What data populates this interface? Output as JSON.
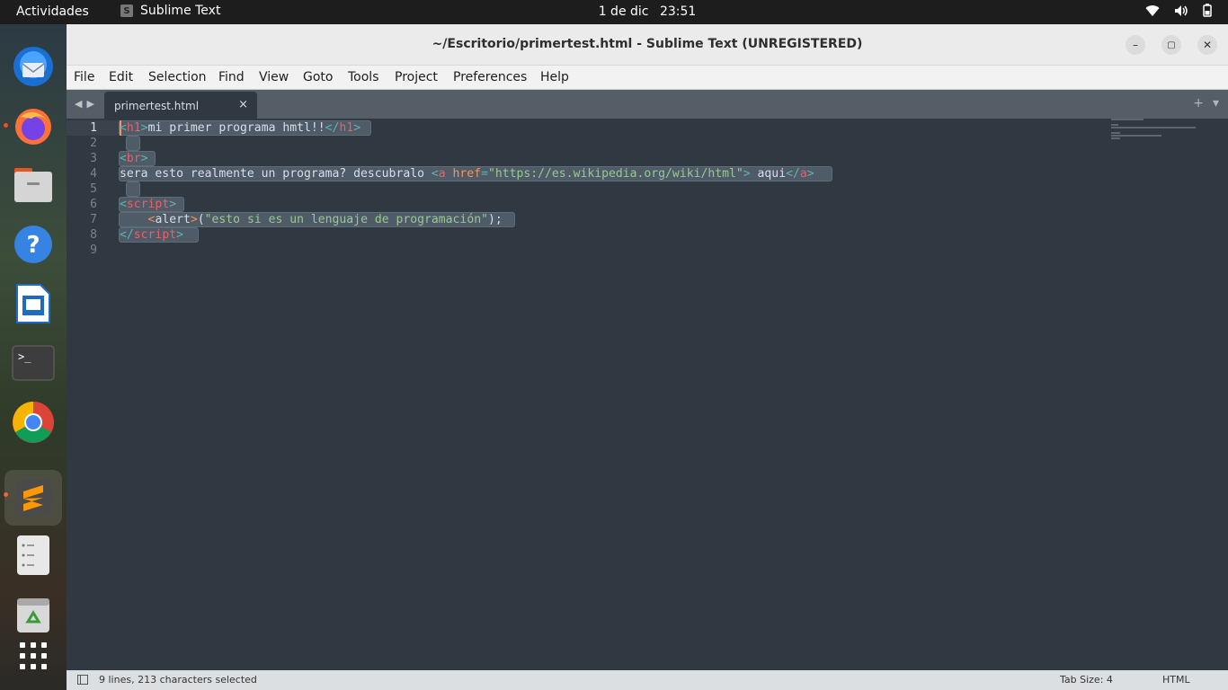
{
  "topbar": {
    "activities": "Actividades",
    "app_name": "Sublime Text",
    "date": "1 de dic",
    "time": "23:51",
    "tray_icons": [
      "wifi-icon",
      "volume-icon",
      "battery-icon"
    ]
  },
  "dock": {
    "items": [
      {
        "name": "thunderbird-icon",
        "active": false,
        "running": false
      },
      {
        "name": "firefox-icon",
        "active": false,
        "running": true
      },
      {
        "name": "files-icon",
        "active": false,
        "running": false
      },
      {
        "name": "help-icon",
        "active": false,
        "running": false
      },
      {
        "name": "libreoffice-writer-icon",
        "active": false,
        "running": false
      },
      {
        "name": "terminal-icon",
        "active": false,
        "running": false
      },
      {
        "name": "chrome-icon",
        "active": false,
        "running": false
      },
      {
        "name": "sublime-text-icon",
        "active": true,
        "running": true
      },
      {
        "name": "text-editor-icon",
        "active": false,
        "running": false
      },
      {
        "name": "trash-icon",
        "active": false,
        "running": false
      },
      {
        "name": "show-apps-icon",
        "active": false,
        "running": false
      }
    ]
  },
  "window": {
    "title": "~/Escritorio/primertest.html - Sublime Text (UNREGISTERED)",
    "controls": {
      "minimize": "–",
      "maximize": "▢",
      "close": "✕"
    }
  },
  "menu": [
    "File",
    "Edit",
    "Selection",
    "Find",
    "View",
    "Goto",
    "Tools",
    "Project",
    "Preferences",
    "Help"
  ],
  "tabs": [
    {
      "label": "primertest.html",
      "close": "×"
    }
  ],
  "tabbar_right": {
    "new_tab": "+",
    "dropdown": "▾"
  },
  "editor": {
    "line_numbers": [
      "1",
      "2",
      "3",
      "4",
      "5",
      "6",
      "7",
      "8",
      "9"
    ],
    "lines": {
      "l1": {
        "o1": "<",
        "t1": "h1",
        "c1": ">",
        "text": "mi primer programa hmtl!!",
        "o2": "</",
        "t2": "h1",
        "c2": ">"
      },
      "l3": {
        "o1": "<",
        "t1": "br",
        "c1": ">"
      },
      "l4": {
        "text": "sera esto realmente un programa? descubralo ",
        "o1": "<",
        "t1": "a",
        "attr": "href",
        "eq": "=",
        "val": "\"https://es.wikipedia.org/wiki/html\"",
        "c1": ">",
        "text2": " aqui",
        "o2": "</",
        "t2": "a",
        "c2": ">"
      },
      "l6": {
        "o1": "<",
        "t1": "script",
        "c1": ">"
      },
      "l7": {
        "indent": "    ",
        "o1": "<",
        "t1": "alert",
        "c1": ">",
        "p1": "(",
        "val": "\"esto si es un lenguaje de programación\"",
        "p2": ");"
      },
      "l8": {
        "o1": "</",
        "t1": "script",
        "c1": ">"
      }
    }
  },
  "status": {
    "selection": "9 lines, 213 characters selected",
    "tab_size": "Tab Size: 4",
    "syntax": "HTML"
  },
  "colors": {
    "editor_bg": "#303841",
    "tag": "#ec5f67",
    "punctuation": "#5fb3b3",
    "attribute": "#f99157",
    "string": "#99c794",
    "text": "#d8dee9"
  }
}
